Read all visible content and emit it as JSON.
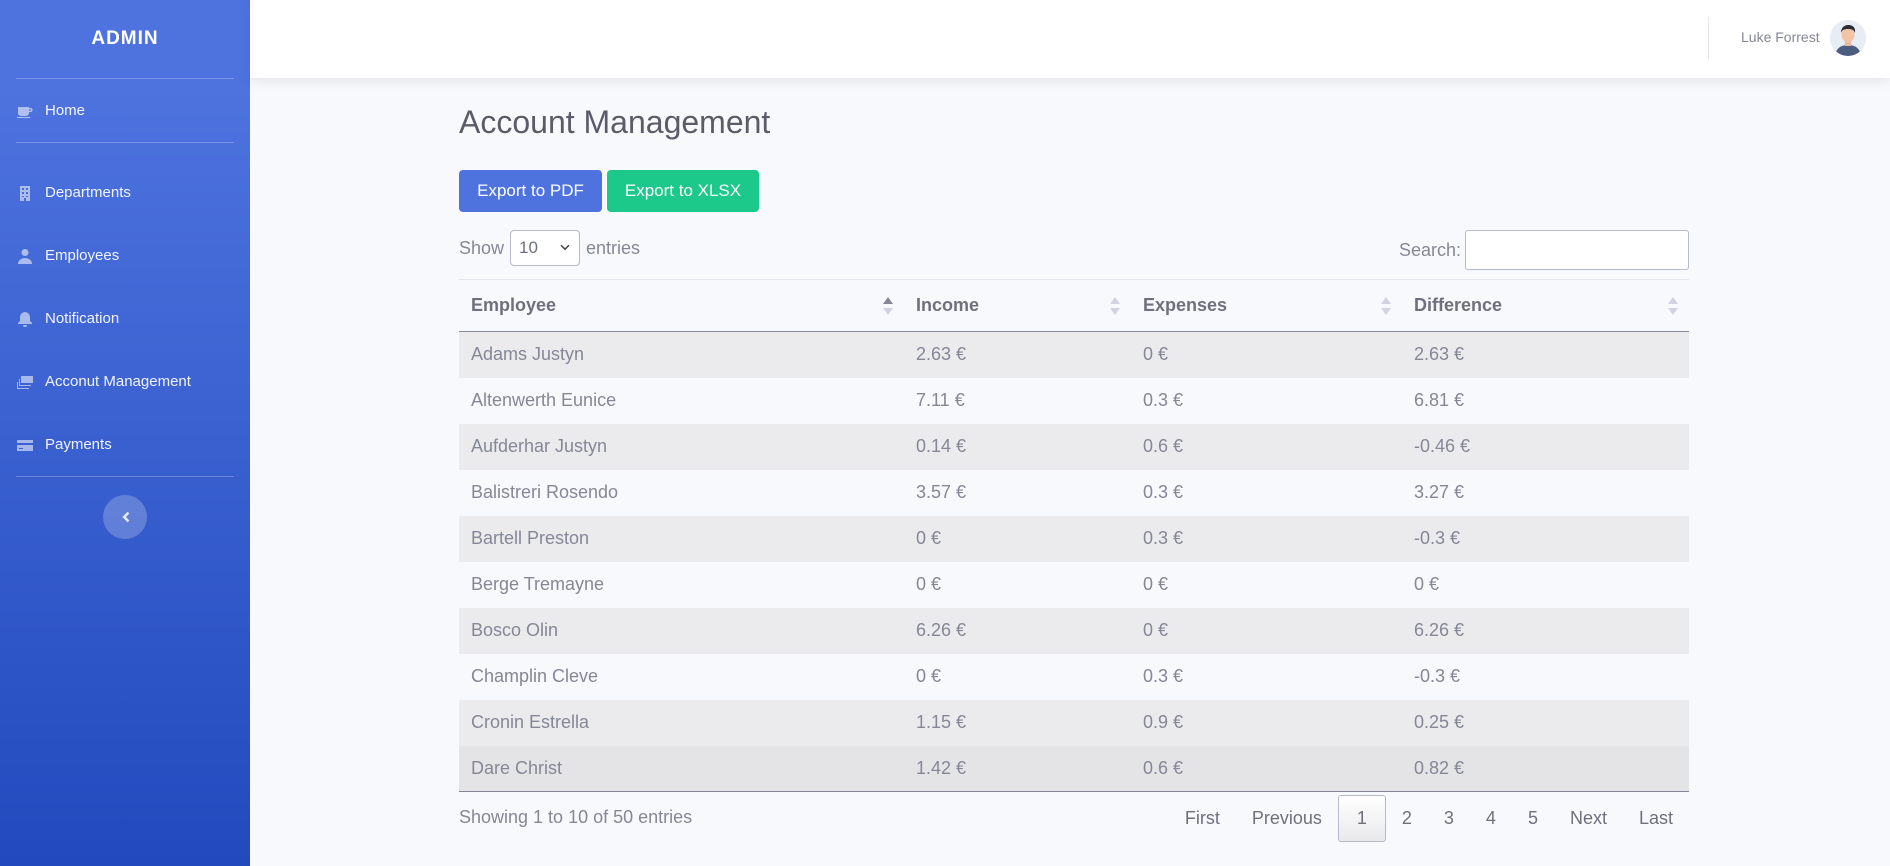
{
  "brand": "ADMIN",
  "sidebar": {
    "items": [
      {
        "label": "Home",
        "icon": "coffee-icon"
      },
      {
        "label": "Departments",
        "icon": "building-icon"
      },
      {
        "label": "Employees",
        "icon": "user-icon"
      },
      {
        "label": "Notification",
        "icon": "bell-icon"
      },
      {
        "label": "Acconut Management",
        "icon": "money-icon"
      },
      {
        "label": "Payments",
        "icon": "credit-card-icon"
      }
    ],
    "toggle_icon": "chevron-left-icon"
  },
  "topbar": {
    "user_name": "Luke Forrest"
  },
  "page": {
    "title": "Account Management",
    "export_pdf": "Export to PDF",
    "export_xlsx": "Export to XLSX",
    "show_label": "Show",
    "entries_label": "entries",
    "page_length": "10",
    "search_label": "Search:"
  },
  "table": {
    "headers": [
      "Employee",
      "Income",
      "Expenses",
      "Difference"
    ],
    "rows": [
      [
        "Adams Justyn",
        "2.63 €",
        "0 €",
        "2.63 €"
      ],
      [
        "Altenwerth Eunice",
        "7.11 €",
        "0.3 €",
        "6.81 €"
      ],
      [
        "Aufderhar Justyn",
        "0.14 €",
        "0.6 €",
        "-0.46 €"
      ],
      [
        "Balistreri Rosendo",
        "3.57 €",
        "0.3 €",
        "3.27 €"
      ],
      [
        "Bartell Preston",
        "0 €",
        "0.3 €",
        "-0.3 €"
      ],
      [
        "Berge Tremayne",
        "0 €",
        "0 €",
        "0 €"
      ],
      [
        "Bosco Olin",
        "6.26 €",
        "0 €",
        "6.26 €"
      ],
      [
        "Champlin Cleve",
        "0 €",
        "0.3 €",
        "-0.3 €"
      ],
      [
        "Cronin Estrella",
        "1.15 €",
        "0.9 €",
        "0.25 €"
      ],
      [
        "Dare Christ",
        "1.42 €",
        "0.6 €",
        "0.82 €"
      ]
    ],
    "info": "Showing 1 to 10 of 50 entries"
  },
  "pagination": {
    "first": "First",
    "previous": "Previous",
    "pages": [
      "1",
      "2",
      "3",
      "4",
      "5"
    ],
    "active": "1",
    "next": "Next",
    "last": "Last"
  },
  "colors": {
    "primary": "#4e73df",
    "success": "#1cc88a"
  }
}
